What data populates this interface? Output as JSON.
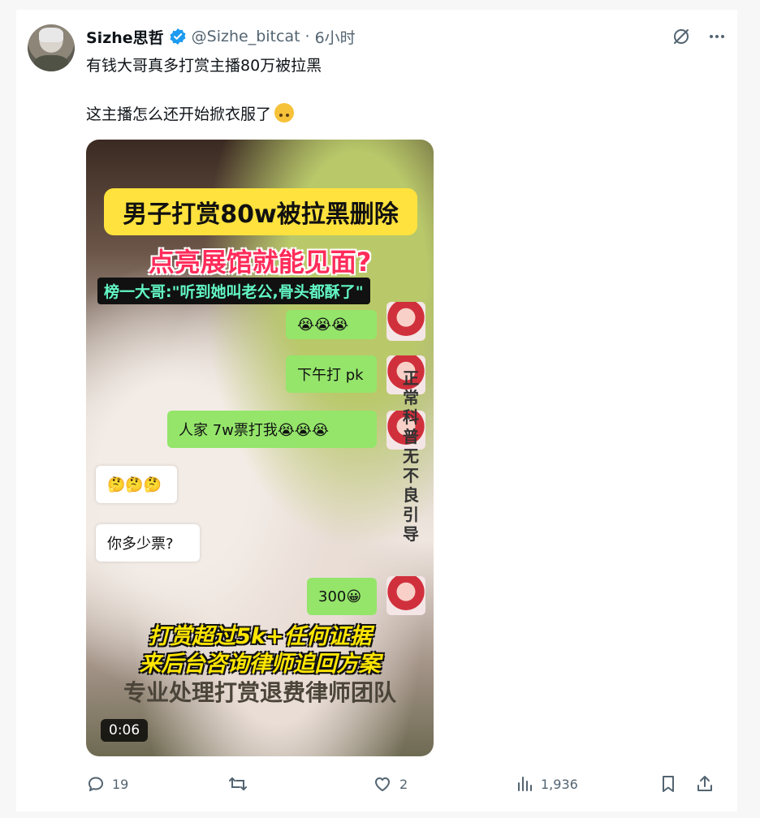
{
  "post": {
    "author_name": "Sizhe思哲",
    "handle": "@Sizhe_bitcat",
    "separator": "·",
    "time": "6小时",
    "text_line1": "有钱大哥真多打赏主播80万被拉黑",
    "text_line2": "这主播怎么还开始掀衣服了",
    "icons": {
      "avatar": "user-avatar",
      "verified": "verified-badge-icon",
      "grok": "grok-icon",
      "more": "more-icon",
      "emoji": "upside-down-face-emoji"
    }
  },
  "video": {
    "banner": "男子打赏80w被拉黑删除",
    "subtitle": "点亮展馆就能见面?",
    "quote": "榜一大哥:\"听到她叫老公,骨头都酥了\"",
    "bubbles": [
      "😭😭😭",
      "下午打 pk",
      "人家 7w票打我😭😭😭",
      "🤔🤔🤔",
      "你多少票?",
      "300😀"
    ],
    "vertical_notice": "正常科普无不良引导",
    "yellow_line1": "打赏超过5k+任何证据",
    "yellow_line2": "来后台咨询律师追回方案",
    "bottom_line": "专业处理打赏退费律师团队",
    "duration": "0:06"
  },
  "actions": {
    "reply_count": "19",
    "retweet_count": "",
    "like_count": "2",
    "view_count": "1,936",
    "colors": {
      "icon": "#536471",
      "verified": "#1d9bf0"
    }
  }
}
